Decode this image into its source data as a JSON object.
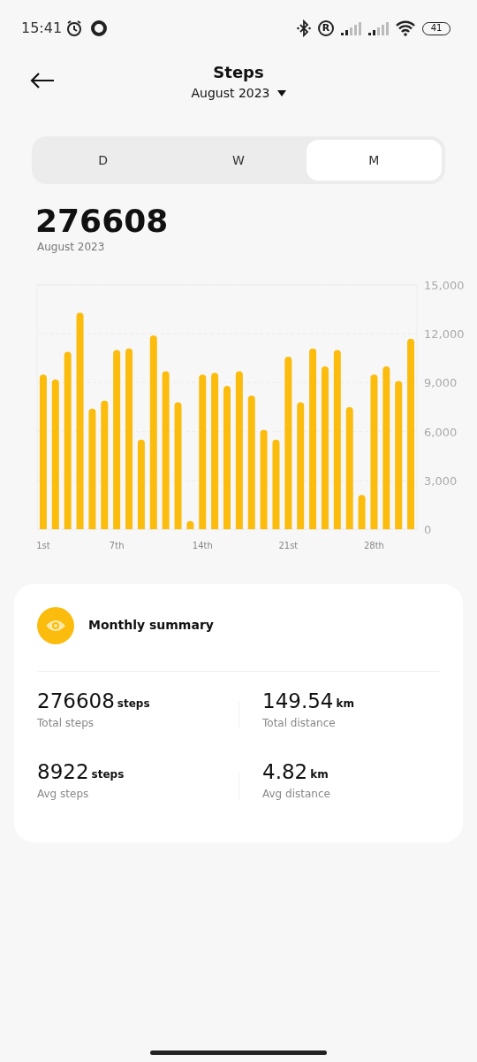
{
  "status_bar": {
    "time": "15:41",
    "roaming": "R",
    "battery": "41"
  },
  "header": {
    "title": "Steps",
    "period": "August 2023"
  },
  "tabs": [
    {
      "label": "D",
      "selected": false
    },
    {
      "label": "W",
      "selected": false
    },
    {
      "label": "M",
      "selected": true
    }
  ],
  "total": {
    "value": "276608",
    "caption": "August 2023"
  },
  "chart_data": {
    "type": "bar",
    "x": [
      1,
      2,
      3,
      4,
      5,
      6,
      7,
      8,
      9,
      10,
      11,
      12,
      13,
      14,
      15,
      16,
      17,
      18,
      19,
      20,
      21,
      22,
      23,
      24,
      25,
      26,
      27,
      28,
      29,
      30,
      31
    ],
    "series": [
      {
        "color": "#fbbc0d",
        "values": [
          9500,
          9200,
          10900,
          13300,
          7400,
          7900,
          11000,
          11100,
          5500,
          11900,
          9700,
          7800,
          500,
          9500,
          9600,
          8800,
          9700,
          8200,
          6100,
          5500,
          10600,
          7800,
          11100,
          10000,
          11000,
          7500,
          2100,
          9500,
          10000,
          9100,
          11700
        ]
      }
    ],
    "xlim": [
      0.5,
      31.5
    ],
    "ylim": [
      0,
      15000
    ],
    "grid": true,
    "yticks": [
      {
        "value": 0,
        "label": "0"
      },
      {
        "value": 3000,
        "label": "3,000"
      },
      {
        "value": 6000,
        "label": "6,000"
      },
      {
        "value": 9000,
        "label": "9,000"
      },
      {
        "value": 12000,
        "label": "12,000"
      },
      {
        "value": 15000,
        "label": "15,000"
      }
    ],
    "xticks": [
      {
        "value": 1,
        "label": "1st"
      },
      {
        "value": 7,
        "label": "7th"
      },
      {
        "value": 14,
        "label": "14th"
      },
      {
        "value": 21,
        "label": "21st"
      },
      {
        "value": 28,
        "label": "28th"
      }
    ]
  },
  "summary": {
    "title": "Monthly summary",
    "metrics": [
      {
        "value": "276608",
        "unit": "steps",
        "label": "Total steps"
      },
      {
        "value": "149.54",
        "unit": "km",
        "label": "Total distance"
      },
      {
        "value": "8922",
        "unit": "steps",
        "label": "Avg steps"
      },
      {
        "value": "4.82",
        "unit": "km",
        "label": "Avg distance"
      }
    ]
  }
}
